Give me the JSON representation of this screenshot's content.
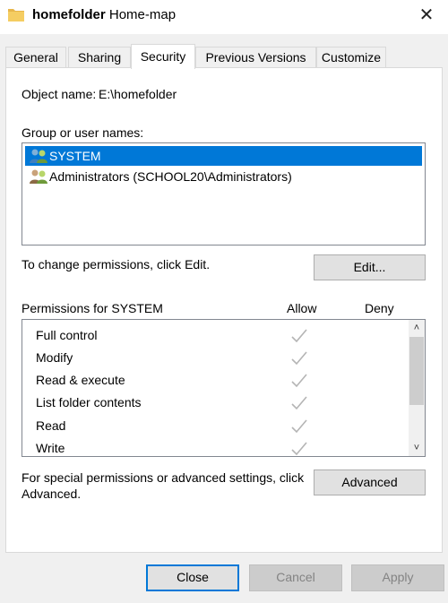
{
  "window": {
    "folder_name": "homefolder",
    "subtitle": "Home-map",
    "close_symbol": "✕"
  },
  "tabs": [
    {
      "label": "General",
      "active": false
    },
    {
      "label": "Sharing",
      "active": false
    },
    {
      "label": "Security",
      "active": true
    },
    {
      "label": "Previous Versions",
      "active": false
    },
    {
      "label": "Customize",
      "active": false
    }
  ],
  "security": {
    "object_name_label": "Object name:",
    "object_name_value": "E:\\homefolder",
    "group_label": "Group or user names:",
    "users": [
      {
        "name": "SYSTEM",
        "selected": true,
        "icon": "users-icon"
      },
      {
        "name": "Administrators (SCHOOL20\\Administrators)",
        "selected": false,
        "icon": "users-icon"
      }
    ],
    "change_text": "To change permissions, click Edit.",
    "edit_button": "Edit...",
    "permissions_label": "Permissions for SYSTEM",
    "allow_header": "Allow",
    "deny_header": "Deny",
    "permissions": [
      {
        "name": "Full control",
        "allow": true,
        "deny": false
      },
      {
        "name": "Modify",
        "allow": true,
        "deny": false
      },
      {
        "name": "Read & execute",
        "allow": true,
        "deny": false
      },
      {
        "name": "List folder contents",
        "allow": true,
        "deny": false
      },
      {
        "name": "Read",
        "allow": true,
        "deny": false
      },
      {
        "name": "Write",
        "allow": true,
        "deny": false
      }
    ],
    "special_text": "For special permissions or advanced settings, click Advanced.",
    "advanced_button": "Advanced"
  },
  "footer": {
    "close_button": "Close",
    "cancel_button": "Cancel",
    "apply_button": "Apply"
  },
  "colors": {
    "selection": "#0078d7",
    "check_disabled": "#b4b4b4"
  }
}
